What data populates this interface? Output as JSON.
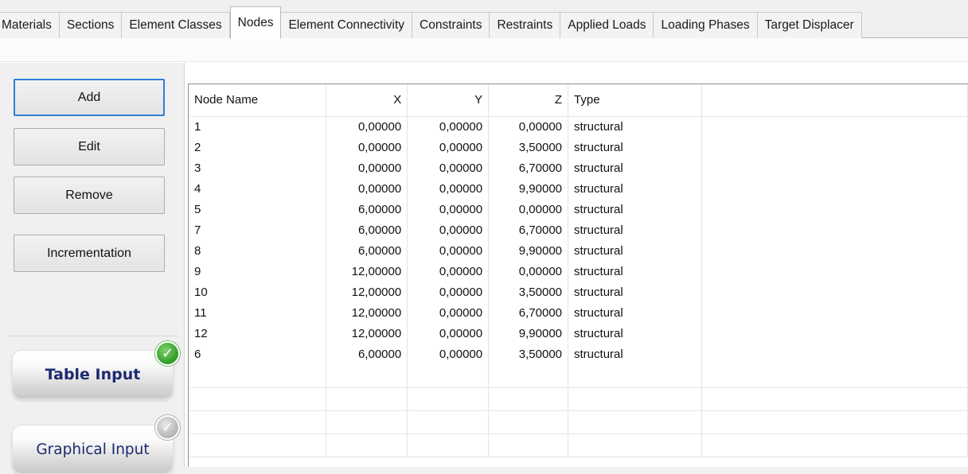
{
  "tabs": [
    {
      "label": "Materials",
      "active": false
    },
    {
      "label": "Sections",
      "active": false
    },
    {
      "label": "Element Classes",
      "active": false
    },
    {
      "label": "Nodes",
      "active": true
    },
    {
      "label": "Element Connectivity",
      "active": false
    },
    {
      "label": "Constraints",
      "active": false
    },
    {
      "label": "Restraints",
      "active": false
    },
    {
      "label": "Applied Loads",
      "active": false
    },
    {
      "label": "Loading Phases",
      "active": false
    },
    {
      "label": "Target Displacer",
      "active": false
    }
  ],
  "buttons": {
    "add": "Add",
    "edit": "Edit",
    "remove": "Remove",
    "incrementation": "Incrementation"
  },
  "input_modes": {
    "table": {
      "label": "Table Input",
      "selected": true,
      "icon": "check-icon"
    },
    "graphical": {
      "label": "Graphical Input",
      "selected": false,
      "icon": "check-icon"
    }
  },
  "grid": {
    "columns": [
      "Node Name",
      "X",
      "Y",
      "Z",
      "Type"
    ],
    "rows": [
      [
        "1",
        "0,00000",
        "0,00000",
        "0,00000",
        "structural"
      ],
      [
        "2",
        "0,00000",
        "0,00000",
        "3,50000",
        "structural"
      ],
      [
        "3",
        "0,00000",
        "0,00000",
        "6,70000",
        "structural"
      ],
      [
        "4",
        "0,00000",
        "0,00000",
        "9,90000",
        "structural"
      ],
      [
        "5",
        "6,00000",
        "0,00000",
        "0,00000",
        "structural"
      ],
      [
        "7",
        "6,00000",
        "0,00000",
        "6,70000",
        "structural"
      ],
      [
        "8",
        "6,00000",
        "0,00000",
        "9,90000",
        "structural"
      ],
      [
        "9",
        "12,00000",
        "0,00000",
        "0,00000",
        "structural"
      ],
      [
        "10",
        "12,00000",
        "0,00000",
        "3,50000",
        "structural"
      ],
      [
        "11",
        "12,00000",
        "0,00000",
        "6,70000",
        "structural"
      ],
      [
        "12",
        "12,00000",
        "0,00000",
        "9,90000",
        "structural"
      ],
      [
        "6",
        "6,00000",
        "0,00000",
        "3,50000",
        "structural"
      ]
    ]
  },
  "colors": {
    "accent_focus": "#2f7fd6",
    "check_on": "#2f9a2a",
    "check_off": "#b4b4b4",
    "mode_text": "#1c2a70"
  }
}
